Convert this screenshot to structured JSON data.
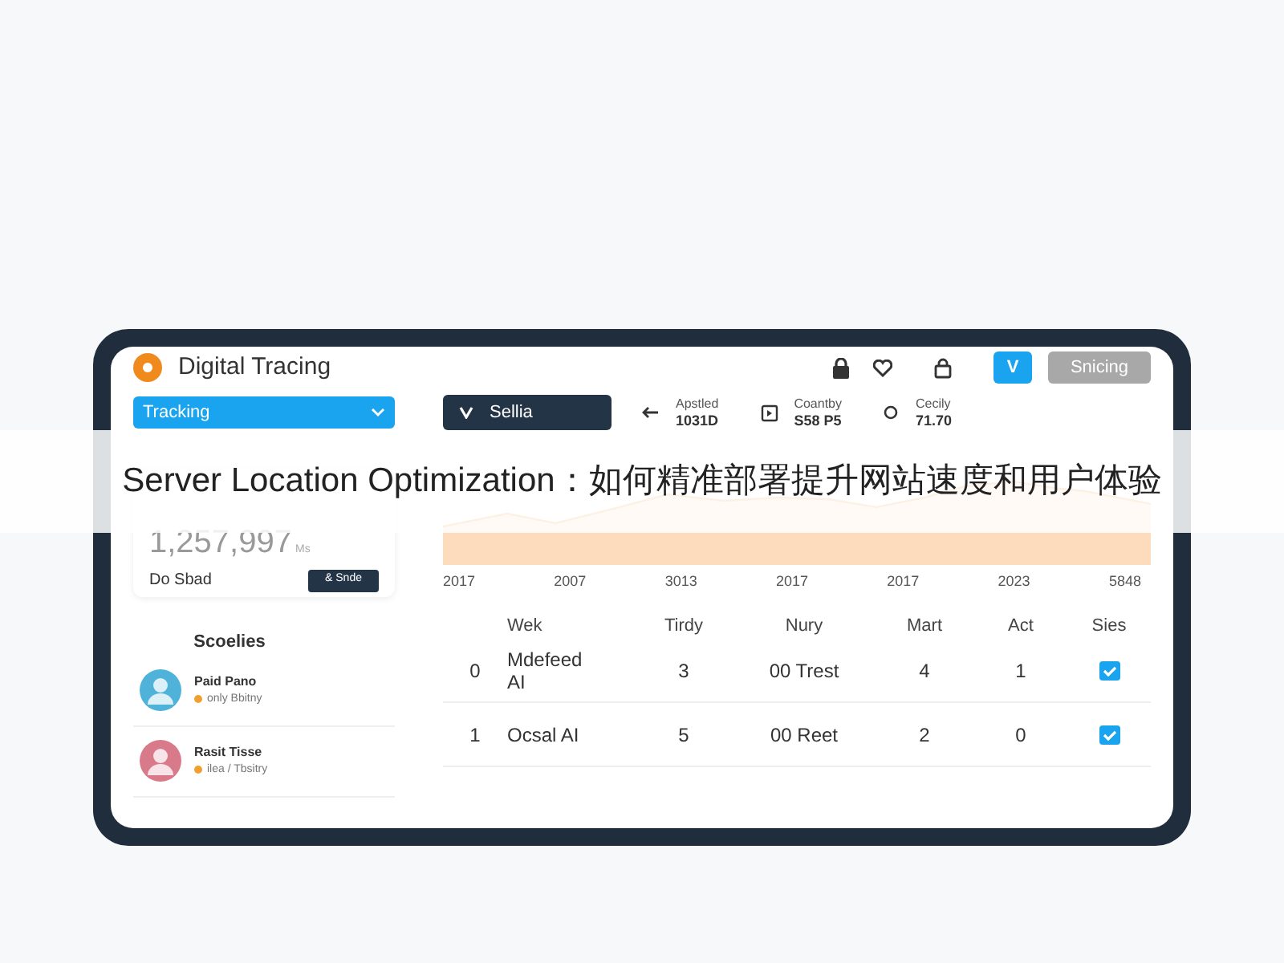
{
  "banner": {
    "title": "Server Location Optimization：如何精准部署提升网站速度和用户体验"
  },
  "header": {
    "app_name": "Digital Tracing",
    "action_button": "V",
    "primary_button": "Snicing"
  },
  "toolbar": {
    "dropdown": "Tracking",
    "dark_button": "Sellia",
    "stats": [
      {
        "label": "Apstled",
        "value": "1031D"
      },
      {
        "label": "Coantby",
        "value": "S58 P5"
      },
      {
        "label": "Cecily",
        "value": "71.70"
      }
    ]
  },
  "summary_card": {
    "value": "1,257,997",
    "unit": "Ms",
    "label": "Do Sbad",
    "button": "& Snde"
  },
  "chart": {
    "x_labels": [
      "2017",
      "2007",
      "3013",
      "2017",
      "2017",
      "2023",
      "5848"
    ]
  },
  "people": {
    "title": "Scoelies",
    "items": [
      {
        "name": "Paid Pano",
        "subtitle": "only Bbitny"
      },
      {
        "name": "Rasit Tisse",
        "subtitle": "ilea / Tbsitry"
      }
    ]
  },
  "table": {
    "columns": [
      "Wek",
      "Tirdy",
      "Nury",
      "Mart",
      "Act",
      "Sies"
    ],
    "rows": [
      {
        "index": "0",
        "cells": [
          "Mdefeed AI",
          "3",
          "00 Trest",
          "4",
          "1"
        ],
        "checked": true
      },
      {
        "index": "1",
        "cells": [
          "Ocsal AI",
          "5",
          "00 Reet",
          "2",
          "0"
        ],
        "checked": true
      }
    ]
  }
}
